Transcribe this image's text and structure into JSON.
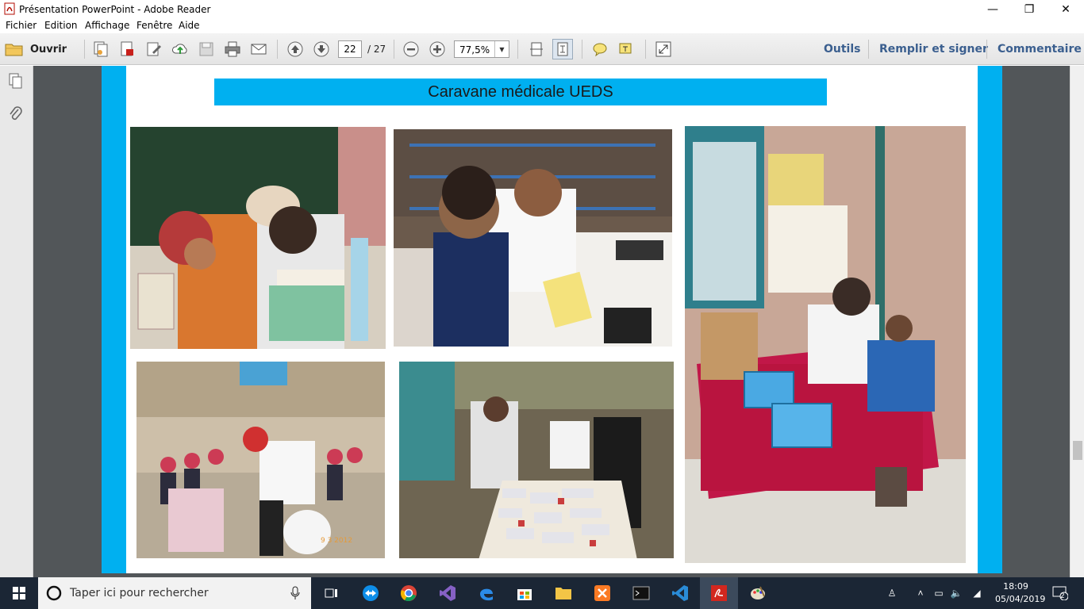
{
  "window": {
    "title": "Présentation PowerPoint - Adobe Reader",
    "minimize": "—",
    "maximize": "❐",
    "close": "✕"
  },
  "menu": [
    "Fichier",
    "Edition",
    "Affichage",
    "Fenêtre",
    "Aide"
  ],
  "toolbar": {
    "open_label": "Ouvrir",
    "page_current": "22",
    "page_total": "/ 27",
    "zoom": "77,5%",
    "tools_label": "Outils",
    "fill_sign_label": "Remplir et signer",
    "comment_label": "Commentaire"
  },
  "slide": {
    "title": "Caravane médicale UEDS",
    "photo_date_stamp": "9  3 2012"
  },
  "taskbar": {
    "search_placeholder": "Taper ici pour rechercher",
    "time": "18:09",
    "date": "05/04/2019",
    "notification_count": "2"
  },
  "colors": {
    "slide_accent": "#00b0f0",
    "taskbar": "#1b2635",
    "link": "#3b5f8f"
  }
}
